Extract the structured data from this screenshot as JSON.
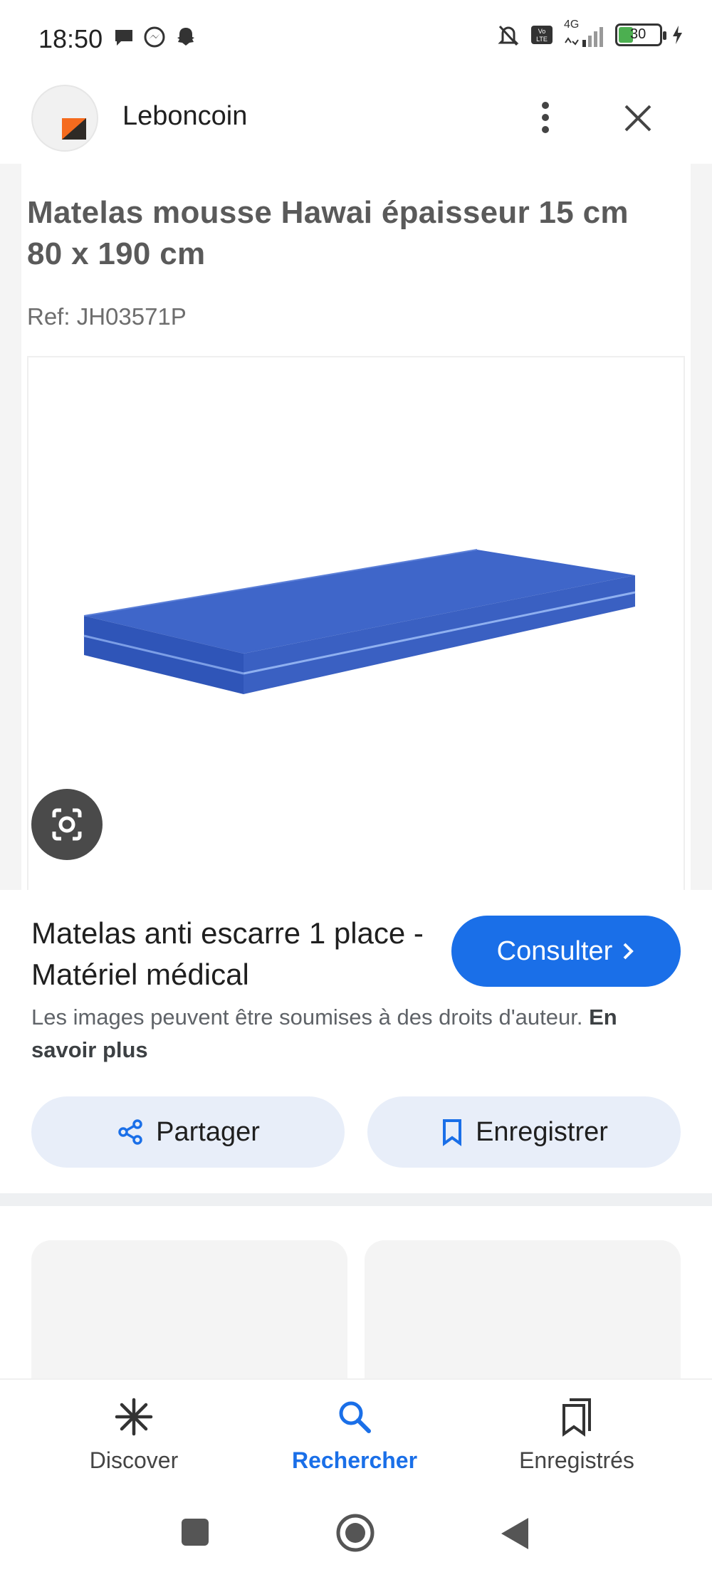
{
  "status_bar": {
    "time": "18:50",
    "network": "4G",
    "battery": "30"
  },
  "header": {
    "site_name": "Leboncoin"
  },
  "image": {
    "title": "Matelas mousse Hawai épaisseur 15 cm 80 x 190 cm",
    "ref": "Ref: JH03571P"
  },
  "result": {
    "title": "Matelas anti escarre 1 place - Matériel médical",
    "consult_label": "Consulter",
    "copyright_text": "Les images peuvent être soumises à des droits d'auteur.",
    "learn_more": "En savoir plus"
  },
  "actions": {
    "share_label": "Partager",
    "save_label": "Enregistrer"
  },
  "bottom_nav": {
    "items": [
      {
        "label": "Discover",
        "icon": "asterisk-icon"
      },
      {
        "label": "Rechercher",
        "icon": "search-icon",
        "active": true
      },
      {
        "label": "Enregistrés",
        "icon": "bookmarks-icon"
      }
    ]
  },
  "colors": {
    "accent": "#1a6fe8",
    "pill_bg": "#e8eef9",
    "mattress": "#3b63c7"
  }
}
